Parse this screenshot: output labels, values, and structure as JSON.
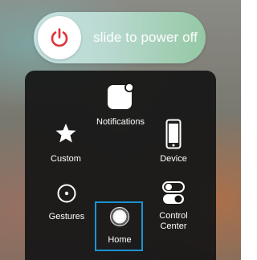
{
  "power_slider": {
    "label": "slide to power off",
    "knob_icon": "power-icon",
    "knob_icon_color": "#e0323a"
  },
  "menu": {
    "items": [
      {
        "id": "notifications",
        "label": "Notifications",
        "icon": "notification-square-icon"
      },
      {
        "id": "custom",
        "label": "Custom",
        "icon": "star-icon"
      },
      {
        "id": "device",
        "label": "Device",
        "icon": "phone-icon"
      },
      {
        "id": "gestures",
        "label": "Gestures",
        "icon": "gesture-circle-icon"
      },
      {
        "id": "home",
        "label": "Home",
        "icon": "home-button-icon",
        "highlighted": true
      },
      {
        "id": "control_center",
        "label": "Control\nCenter",
        "icon": "toggle-icon"
      }
    ],
    "highlight_color": "#1b93d1"
  }
}
